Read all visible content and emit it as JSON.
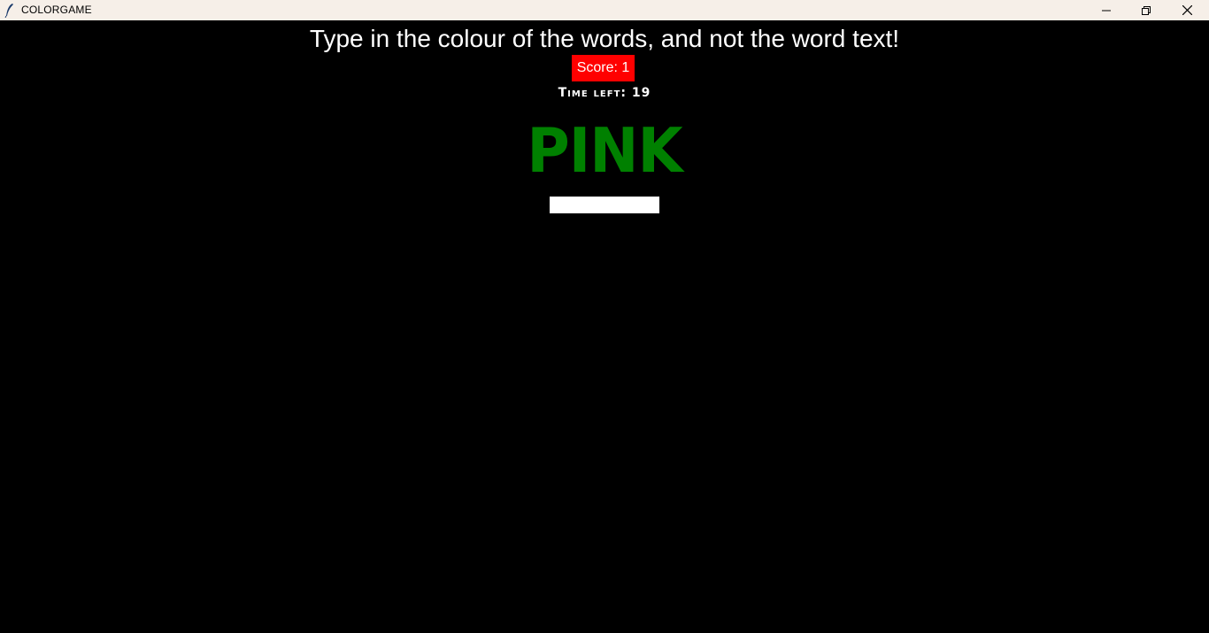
{
  "window": {
    "title": "COLORGAME",
    "app_icon": "feather-icon",
    "controls": {
      "minimize_icon": "minimize-icon",
      "maximize_icon": "restore-icon",
      "close_icon": "close-icon"
    }
  },
  "game": {
    "instructions": "Type in the colour of the words, and not the word text!",
    "score_label": "Score: 1",
    "time_left_label": "Time left: 19",
    "color_word": "PINK",
    "answer_input": {
      "value": "",
      "placeholder": ""
    }
  },
  "colors": {
    "background": "#000000",
    "titlebar": "#f6efe8",
    "score_background": "#ff0000",
    "word_color": "#008000",
    "text": "#ffffff"
  }
}
